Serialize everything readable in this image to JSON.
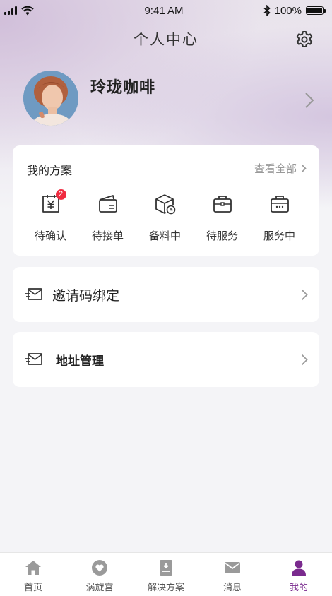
{
  "status_bar": {
    "time": "9:41 AM",
    "battery": "100%"
  },
  "header": {
    "title": "个人中心",
    "settings_icon": "gear-icon"
  },
  "profile": {
    "name": "玲珑咖啡"
  },
  "plans": {
    "title": "我的方案",
    "view_all": "查看全部",
    "items": [
      {
        "label": "待确认",
        "icon": "yuan-receipt-icon",
        "badge": "2"
      },
      {
        "label": "待接单",
        "icon": "wallet-icon"
      },
      {
        "label": "备料中",
        "icon": "box-clock-icon"
      },
      {
        "label": "待服务",
        "icon": "briefcase-icon"
      },
      {
        "label": "服务中",
        "icon": "briefcase-dots-icon"
      }
    ]
  },
  "menu": {
    "invite": {
      "label": "邀请码绑定",
      "icon": "envelope-icon"
    },
    "address": {
      "label": "地址管理",
      "icon": "envelope-icon"
    }
  },
  "tabbar": {
    "items": [
      {
        "label": "首页",
        "icon": "home-icon"
      },
      {
        "label": "涡旋宫",
        "icon": "heart-bubble-icon"
      },
      {
        "label": "解决方案",
        "icon": "book-icon"
      },
      {
        "label": "消息",
        "icon": "mail-icon"
      },
      {
        "label": "我的",
        "icon": "person-icon",
        "active": true
      }
    ]
  },
  "colors": {
    "accent": "#7a2a8e",
    "badge": "#f02b40",
    "background": "#f4f4f7"
  }
}
